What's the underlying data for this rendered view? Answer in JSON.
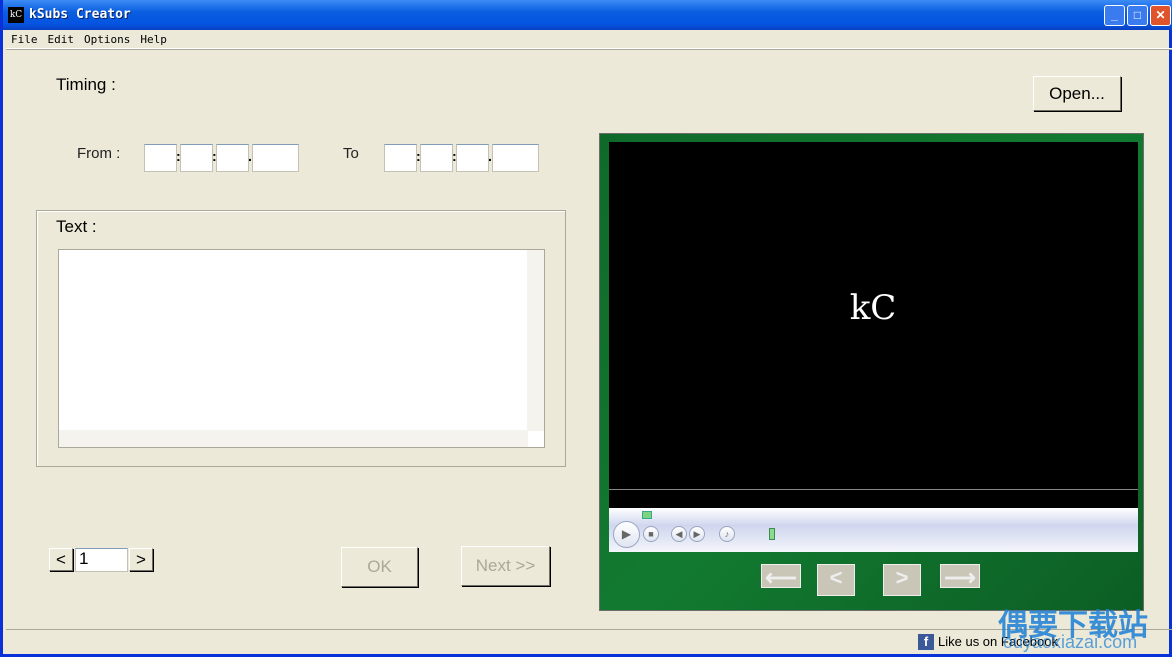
{
  "window": {
    "title": "kSubs Creator",
    "icon": "kC"
  },
  "menu": [
    "File",
    "Edit",
    "Options",
    "Help"
  ],
  "timing": {
    "label": "Timing :",
    "from_label": "From :",
    "to_label": "To",
    "from": [
      "",
      "",
      "",
      ""
    ],
    "to": [
      "",
      "",
      "",
      ""
    ]
  },
  "open_button": "Open...",
  "text": {
    "label": "Text :",
    "value": ""
  },
  "pager": {
    "prev": "<",
    "value": "1",
    "next": ">"
  },
  "buttons": {
    "ok": "OK",
    "next": "Next >>"
  },
  "player": {
    "logo": "kC"
  },
  "footer": {
    "facebook": "Like us on Facebook"
  },
  "watermark": {
    "text": "偶要下载站",
    "url": "ouyaoxiazai.com"
  }
}
